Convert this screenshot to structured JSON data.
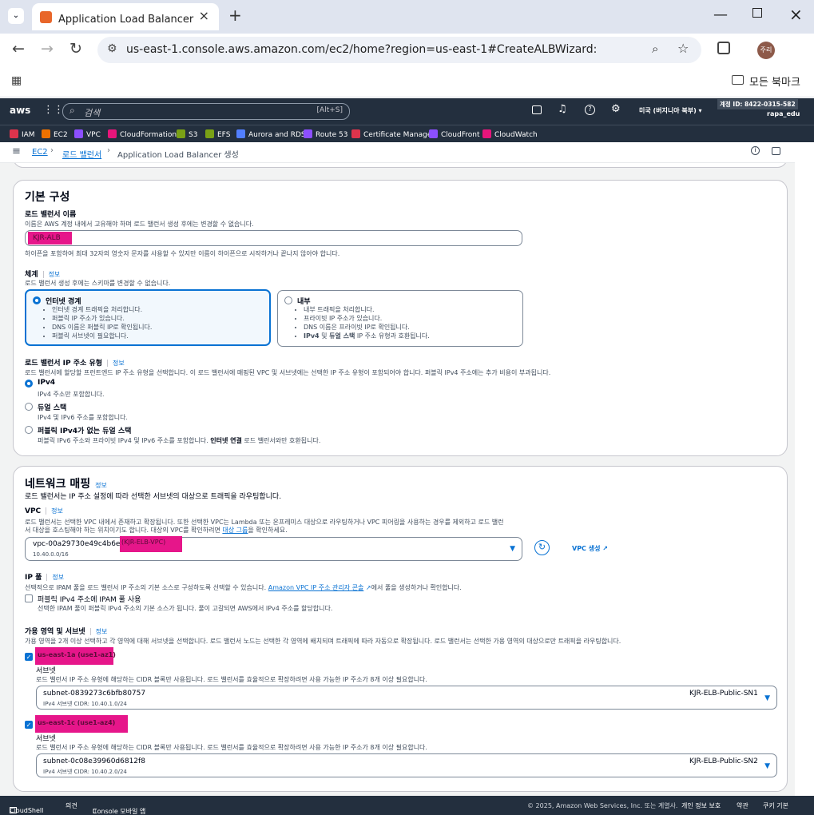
{
  "browser": {
    "tab_title": "Application Load Balancer 생성",
    "url": "us-east-1.console.aws.amazon.com/ec2/home?region=us-east-1#CreateALBWizard:",
    "profile_initial": "주리",
    "bookmark_folder": "모든 북마크"
  },
  "aws_header": {
    "search_placeholder": "검색",
    "search_shortcut": "[Alt+S]",
    "region": "미국 (버지니아 북부) ▾",
    "account_id": "계정 ID: 8422-0315-582",
    "account_user": "rapa_edu"
  },
  "services": [
    {
      "label": "IAM",
      "color": "#dd344c"
    },
    {
      "label": "EC2",
      "color": "#ed7100"
    },
    {
      "label": "VPC",
      "color": "#8c4fff"
    },
    {
      "label": "CloudFormation",
      "color": "#e7157b"
    },
    {
      "label": "S3",
      "color": "#7aa116"
    },
    {
      "label": "EFS",
      "color": "#7aa116"
    },
    {
      "label": "Aurora and RDS",
      "color": "#527fff"
    },
    {
      "label": "Route 53",
      "color": "#8c4fff"
    },
    {
      "label": "Certificate Manager",
      "color": "#dd344c"
    },
    {
      "label": "CloudFront",
      "color": "#8c4fff"
    },
    {
      "label": "CloudWatch",
      "color": "#e7157b"
    }
  ],
  "breadcrumb": {
    "ec2": "EC2",
    "lb": "로드 밸런서",
    "current": "Application Load Balancer 생성"
  },
  "basic": {
    "title": "기본 구성",
    "name_label": "로드 밸런서 이름",
    "name_desc": "이름은 AWS 계정 내에서 고유해야 하며 로드 밸런서 생성 후에는 변경할 수 없습니다.",
    "name_value": "KJR-ALB",
    "name_hint": "하이픈을 포함하여 최대 32자의 영숫자 문자를 사용할 수 있지만 이름이 하이픈으로 시작하거나 끝나지 않아야 합니다.",
    "scheme_label": "체계",
    "info": "정보",
    "scheme_desc": "로드 밸런서 생성 후에는 스키마를 변경할 수 없습니다.",
    "internet": {
      "title": "인터넷 경계",
      "items": [
        "인터넷 경계 트래픽을 처리합니다.",
        "퍼블릭 IP 주소가 있습니다.",
        "DNS 이름은 퍼블릭 IP로 확인됩니다.",
        "퍼블릭 서브넷이 필요합니다."
      ]
    },
    "internal": {
      "title": "내부",
      "items": [
        "내부 트래픽을 처리합니다.",
        "프라이빗 IP 주소가 있습니다.",
        "DNS 이름은 프라이빗 IP로 확인됩니다."
      ],
      "last_bold1": "IPv4",
      "last_mid": " 및 ",
      "last_bold2": "듀얼 스택",
      "last_rest": " IP 주소 유형과 호환됩니다."
    },
    "ip_type_label": "로드 밸런서 IP 주소 유형",
    "ip_type_desc": "로드 밸런서에 할당할 프런트엔드 IP 주소 유형을 선택합니다. 이 로드 밸런서에 매핑된 VPC 및 서브넷에는 선택한 IP 주소 유형이 포함되어야 합니다. 퍼블릭 IPv4 주소에는 추가 비용이 부과됩니다.",
    "ipv4": "IPv4",
    "ipv4_desc": "IPv4 주소만 포함합니다.",
    "dual": "듀얼 스택",
    "dual_desc": "IPv4 및 IPv6 주소를 포함합니다.",
    "dual_nopub": "퍼블릭 IPv4가 없는 듀얼 스택",
    "dual_nopub_desc1": "퍼블릭 IPv6 주소와 프라이빗 IPv4 및 IPv6 주소를 포함합니다. ",
    "dual_nopub_bold": "인터넷 연결",
    "dual_nopub_desc2": " 로드 밸런서와만 호환됩니다."
  },
  "network": {
    "title": "네트워크 매핑",
    "info": "정보",
    "desc": "로드 밸런서는 IP 주소 설정에 따라 선택한 서브넷의 대상으로 트래픽을 라우팅합니다.",
    "vpc_label": "VPC",
    "vpc_desc1": "로드 밸런서는 선택한 VPC 내에서 존재하고 확장됩니다. 또한 선택한 VPC는 Lambda 또는 온프레미스 대상으로 라우팅하거나 VPC 피어링을 사용하는 경우를 제외하고 로드 밸런",
    "vpc_desc2": "서 대상을 호스팅해야 하는 위치이기도 합니다. 대상의 VPC를 확인하려면 ",
    "vpc_desc_link": "대상 그룹",
    "vpc_desc3": "을 확인하세요.",
    "vpc_id": "vpc-00a29730e49c4b6e8",
    "vpc_name": "(KJR-ELB-VPC)",
    "vpc_cidr": "10.40.0.0/16",
    "vpc_create": "VPC 생성",
    "ippool_label": "IP 풀",
    "ippool_desc1": "선택적으로 IPAM 풀을 로드 밸런서 IP 주소의 기본 소스로 구성하도록 선택할 수 있습니다. ",
    "ippool_link": "Amazon VPC IP 주소 관리자 콘솔",
    "ippool_desc2": "에서 풀을 생성하거나 확인합니다.",
    "ipam_check": "퍼블릭 IPv4 주소에 IPAM 풀 사용",
    "ipam_desc": "선택한 IPAM 풀이 퍼블릭 IPv4 주소의 기본 소스가 됩니다. 풀이 고갈되면 AWS에서 IPv4 주소를 할당합니다.",
    "az_label": "가용 영역 및 서브넷",
    "az_desc": "가용 영역을 2개 이상 선택하고 각 영역에 대해 서브넷을 선택합니다. 로드 밸런서 노드는 선택한 각 영역에 배치되며 트래픽에 따라 자동으로 확장됩니다. 로드 밸런서는 선택한 가용 영역의 대상으로만 트래픽을 라우팅합니다.",
    "subnet_label": "서브넷",
    "subnet_desc": "로드 밸런서 IP 주소 유형에 해당하는 CIDR 블록만 사용됩니다. 로드 밸런서를 효율적으로 확장하려면 사용 가능한 IP 주소가 8개 이상 필요합니다.",
    "zones": [
      {
        "az": "us-east-1a (use1-az1)",
        "subnet_id": "subnet-0839273c6bfb80757",
        "cidr": "IPv4 서브넷 CIDR: 10.40.1.0/24",
        "subnet_name": "KJR-ELB-Public-SN1"
      },
      {
        "az": "us-east-1c (use1-az4)",
        "subnet_id": "subnet-0c08e39960d6812f8",
        "cidr": "IPv4 서브넷 CIDR: 10.40.2.0/24",
        "subnet_name": "KJR-ELB-Public-SN2"
      }
    ]
  },
  "footer": {
    "cloudshell": "CloudShell",
    "feedback": "의견",
    "mobile": "Console 모바일 앱",
    "copyright": "© 2025, Amazon Web Services, Inc. 또는 계열사.",
    "privacy": "개인 정보 보호",
    "terms": "약관",
    "cookie": "쿠키 기본"
  }
}
